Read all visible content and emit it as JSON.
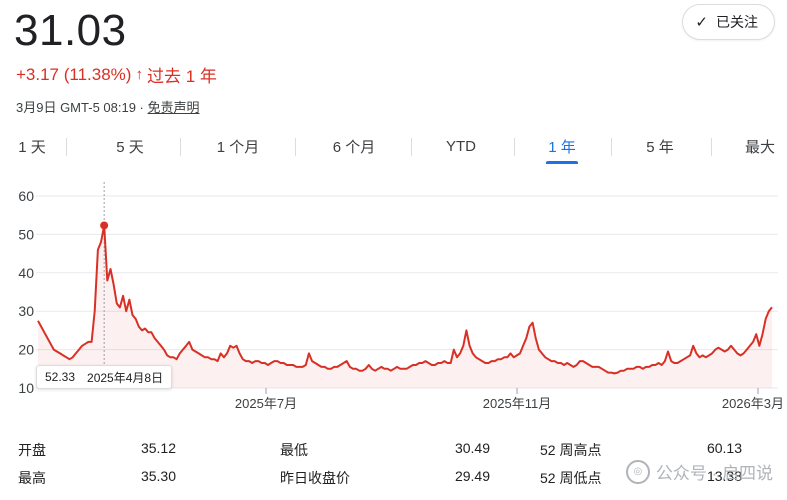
{
  "quote": {
    "price": "31.03",
    "change": "+3.17 (11.38%)",
    "change_arrow": "↑",
    "period_label": "过去 1 年",
    "timestamp": "3月9日 GMT-5 08:19 · ",
    "disclaimer": "免责声明",
    "accent_down": "#d93025"
  },
  "follow_button": {
    "label": "已关注",
    "icon": "check-icon"
  },
  "tabs": [
    {
      "label": "1 天"
    },
    {
      "label": "5 天"
    },
    {
      "label": "1 个月"
    },
    {
      "label": "6 个月"
    },
    {
      "label": "YTD"
    },
    {
      "label": "1 年",
      "active": true
    },
    {
      "label": "5 年"
    },
    {
      "label": "最大"
    }
  ],
  "tooltip": {
    "value": "52.33",
    "date": "2025年4月8日"
  },
  "chart_data": {
    "type": "line",
    "y_ticks": [
      "60",
      "50",
      "40",
      "30",
      "20",
      "10"
    ],
    "ylim": [
      10,
      60
    ],
    "x_ticks": [
      "2025年7月",
      "2025年11月",
      "2026年3月"
    ],
    "color": "#d93025",
    "highlight": {
      "value": 52.33,
      "date": "2025年4月8日"
    },
    "series": [
      {
        "values": [
          27.5,
          26,
          24.5,
          23,
          21.5,
          20,
          19.5,
          19,
          18.5,
          18,
          17.5,
          18,
          19,
          20,
          21,
          21.5,
          22,
          22,
          30,
          46,
          48,
          52.33,
          38,
          41,
          37,
          32,
          31,
          34,
          30,
          33,
          29,
          28,
          26,
          25,
          25.5,
          24.5,
          24.5,
          23,
          22,
          21,
          20,
          18.5,
          18,
          18,
          17.5,
          19,
          20,
          21,
          22,
          20,
          19.5,
          19,
          18.5,
          18,
          18,
          17.5,
          17.5,
          17,
          19,
          18,
          19,
          21,
          20.5,
          21,
          19,
          17.5,
          17,
          17,
          16.5,
          17,
          17,
          16.5,
          16.5,
          16,
          16.5,
          17,
          17,
          16.5,
          16.5,
          16,
          16,
          16,
          15.5,
          15.5,
          15.5,
          16,
          19,
          17,
          16.5,
          16,
          15.5,
          15.5,
          15,
          15,
          15.5,
          15.5,
          16,
          16.5,
          17,
          15.5,
          15,
          15,
          14.5,
          14.5,
          15,
          16,
          15,
          14.5,
          15,
          15.5,
          15,
          15,
          14.5,
          15,
          15.5,
          15,
          15,
          15,
          15.5,
          16,
          16,
          16.5,
          16.5,
          17,
          16.5,
          16,
          16,
          16.5,
          16.5,
          17,
          16.5,
          16.5,
          20,
          18,
          19,
          21,
          25,
          21,
          19,
          18,
          17.5,
          17,
          16.5,
          16.5,
          17,
          17,
          17.5,
          17.5,
          18,
          18,
          19,
          18,
          18.5,
          19,
          21,
          23,
          26,
          27,
          23,
          20,
          19,
          18,
          17.5,
          17,
          17,
          16.5,
          16.5,
          16,
          16.5,
          16,
          15.5,
          16,
          17,
          17,
          16.5,
          16,
          15.5,
          15.5,
          15.5,
          15,
          14.5,
          14,
          14,
          13.8,
          14,
          14.5,
          14.5,
          15,
          15,
          15,
          15.5,
          15.5,
          15,
          15.5,
          15.5,
          16,
          16,
          16.5,
          16,
          17,
          19.5,
          17,
          16.5,
          16.5,
          17,
          17.5,
          18,
          18.5,
          21,
          19,
          18,
          18.5,
          18,
          18.5,
          19,
          20,
          20.5,
          20,
          19.5,
          20,
          21,
          20,
          19,
          18.5,
          19,
          20,
          21,
          22,
          24,
          21,
          24,
          28,
          30,
          31.03
        ]
      }
    ]
  },
  "stats": [
    {
      "label": "开盘",
      "value": "35.12"
    },
    {
      "label": "最高",
      "value": "35.30"
    },
    {
      "label": "最低",
      "value": "30.49"
    },
    {
      "label": "昨日收盘价",
      "value": "29.49"
    },
    {
      "label": "52 周高点",
      "value": "60.13"
    },
    {
      "label": "52 周低点",
      "value": "13.38"
    }
  ],
  "watermark": {
    "text": "公众号 · 启四说"
  }
}
